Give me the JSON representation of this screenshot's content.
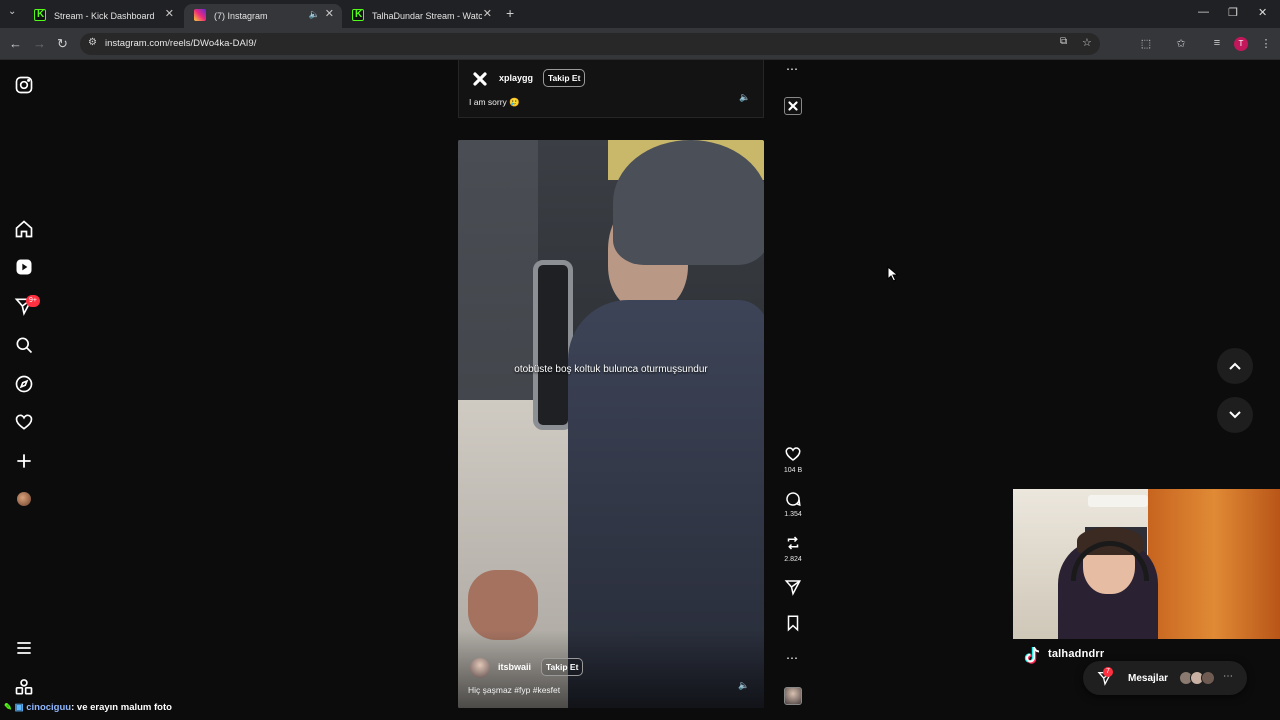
{
  "browser": {
    "tabs": [
      {
        "label": "Stream - Kick Dashboard",
        "favicon": "kick-icon"
      },
      {
        "label": "(7) Instagram",
        "favicon": "instagram-icon",
        "active": true
      },
      {
        "label": "TalhaDundar Stream - Watch Li",
        "favicon": "kick-icon"
      }
    ],
    "url": "instagram.com/reels/DWo4ka-DAI9/",
    "profile_initial": "T"
  },
  "sidebar": {
    "notification_badge": "9+",
    "items": [
      "instagram-logo",
      "home",
      "reels",
      "direct-messages",
      "search",
      "explore",
      "notifications",
      "create",
      "profile",
      "more",
      "also-from-meta"
    ]
  },
  "reels": {
    "previous": {
      "username": "xplaygg",
      "follow_label": "Takip Et",
      "caption": "I am sorry 🥲"
    },
    "current": {
      "overlay_text": "otobüste boş koltuk bulunca oturmuşsundur",
      "username": "itsbwaii",
      "follow_label": "Takip Et",
      "caption": "Hiç şaşmaz #fyp #kesfet"
    },
    "actions": {
      "likes": "104 B",
      "comments": "1.354",
      "reposts": "2.824"
    }
  },
  "stream_overlay": {
    "streamer": "talhadndrr",
    "chat": {
      "user": "cinociguu",
      "message": ": ve erayın malum foto"
    }
  },
  "messages": {
    "label": "Mesajlar",
    "badge": "7"
  },
  "colors": {
    "page_bg": "#0c0c0c",
    "badge_red": "#ff3040",
    "kick_green": "#53fc18"
  }
}
